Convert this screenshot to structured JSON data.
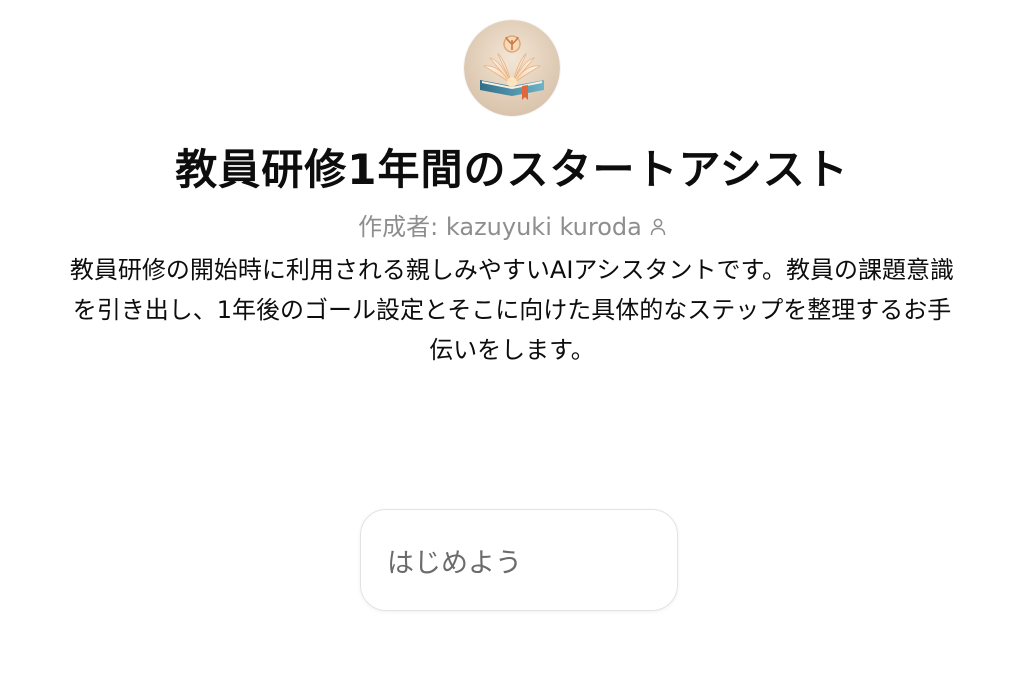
{
  "gpt": {
    "avatar_icon": "open-book-logo-icon",
    "title": "教員研修1年間のスタートアシスト",
    "author_prefix": "作成者: kazuyuki kuroda",
    "author_icon": "person-icon",
    "description": "教員研修の開始時に利用される親しみやすいAIアシスタントです。教員の課題意識を引き出し、1年後のゴール設定とそこに向けた具体的なステップを整理するお手伝いをします。"
  },
  "conversation_starters": [
    {
      "label": "はじめよう"
    }
  ],
  "colors": {
    "title": "#0d0d0d",
    "author": "#8e8e8e",
    "starter_border": "#e3e3e3",
    "starter_text": "#6b6b6b"
  }
}
